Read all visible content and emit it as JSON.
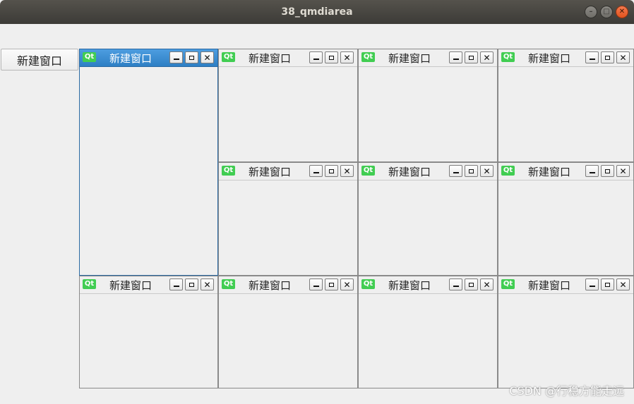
{
  "window": {
    "title": "38_qmdiarea",
    "minimize_glyph": "–",
    "maximize_glyph": "□",
    "close_glyph": "✕"
  },
  "toolbar": {
    "new_window_label": "新建窗口"
  },
  "subwindows": [
    {
      "title": "新建窗口",
      "icon": "Qt",
      "active": true
    },
    {
      "title": "新建窗口",
      "icon": "Qt",
      "active": false
    },
    {
      "title": "新建窗口",
      "icon": "Qt",
      "active": false
    },
    {
      "title": "新建窗口",
      "icon": "Qt",
      "active": false
    },
    {
      "title": "新建窗口",
      "icon": "Qt",
      "active": false
    },
    {
      "title": "新建窗口",
      "icon": "Qt",
      "active": false
    },
    {
      "title": "新建窗口",
      "icon": "Qt",
      "active": false
    },
    {
      "title": "新建窗口",
      "icon": "Qt",
      "active": false
    },
    {
      "title": "新建窗口",
      "icon": "Qt",
      "active": false
    },
    {
      "title": "新建窗口",
      "icon": "Qt",
      "active": false
    },
    {
      "title": "新建窗口",
      "icon": "Qt",
      "active": false
    }
  ],
  "subwindow_buttons": {
    "minimize_icon": "minimize-icon",
    "restore_icon": "restore-icon",
    "close_glyph": "✕"
  },
  "watermark": "CSDN @行稳方能走远",
  "colors": {
    "qt_green": "#41cd52",
    "active_title": "#2d7fc4"
  }
}
